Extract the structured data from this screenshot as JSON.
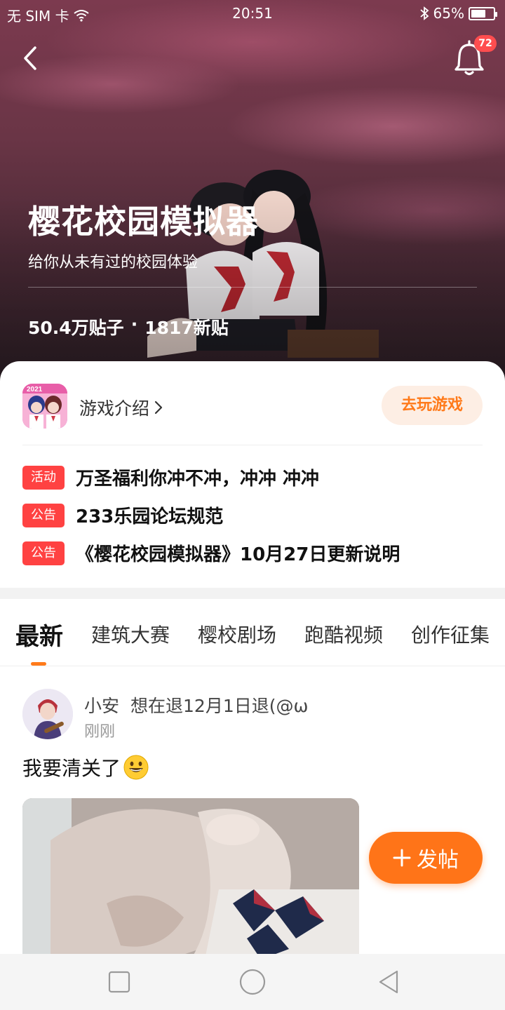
{
  "status_bar": {
    "carrier": "无 SIM 卡",
    "time": "20:51",
    "battery": "65%",
    "battery_level": 0.65
  },
  "header": {
    "notification_count": "72"
  },
  "forum": {
    "title": "樱花校园模拟器",
    "subtitle": "给你从未有过的校园体验",
    "posts_count": "50.4万贴子",
    "separator": "·",
    "new_posts": "1817新贴"
  },
  "game": {
    "intro_label": "游戏介绍",
    "play_button": "去玩游戏",
    "icon_badge": "2021"
  },
  "notices": [
    {
      "tag": "活动",
      "text": "万圣福利你冲不冲，冲冲 冲冲"
    },
    {
      "tag": "公告",
      "text": "233乐园论坛规范"
    },
    {
      "tag": "公告",
      "text": "《樱花校园模拟器》10月27日更新说明"
    }
  ],
  "tabs": [
    "最新",
    "建筑大赛",
    "樱校剧场",
    "跑酷视频",
    "创作征集"
  ],
  "post": {
    "username": "小安",
    "signature": "想在退12月1日退(@ω",
    "time": "刚刚",
    "text": "我要清关了",
    "emoji": "grinning-face"
  },
  "fab": {
    "label": "发帖"
  },
  "nav": [
    "recent-apps",
    "home",
    "back"
  ],
  "colors": {
    "accent": "#ff7418",
    "tag": "#ff4242",
    "badge": "#ff4d4f"
  }
}
